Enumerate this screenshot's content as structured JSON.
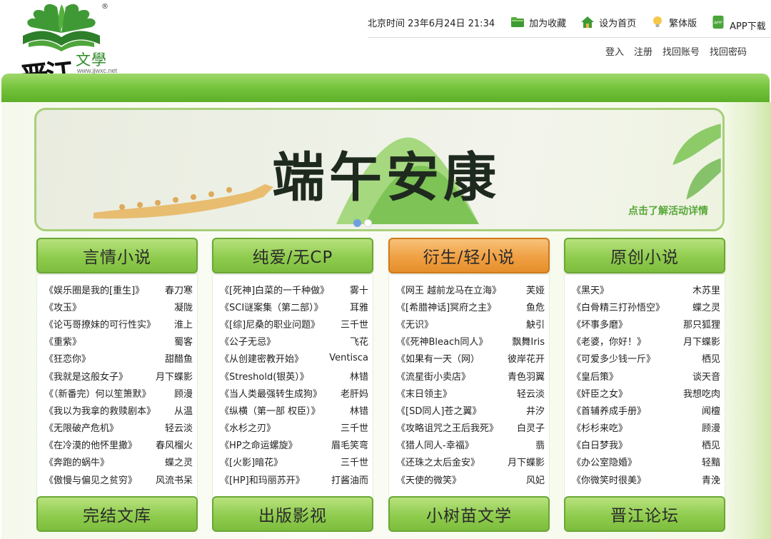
{
  "logo": {
    "brand_big": "晋江",
    "brand_small": "文學城",
    "url": "www.jjwxc.net",
    "reg": "®"
  },
  "topbar": {
    "time_label": "北京时间",
    "time_value": "23年6月24日 21:34",
    "items": [
      {
        "label": "加为收藏",
        "icon": "folder-icon"
      },
      {
        "label": "设为首页",
        "icon": "house-icon"
      },
      {
        "label": "繁体版",
        "icon": "lightbulb-icon"
      },
      {
        "label": "APP下载",
        "icon": "app-icon"
      }
    ]
  },
  "account": {
    "login": "登入",
    "register": "注册",
    "find_account": "找回账号",
    "find_password": "找回密码"
  },
  "banner": {
    "slogan": "端午安康",
    "detail": "点击了解活动详情"
  },
  "colors": {
    "green_accent": "#79c63f",
    "orange_accent": "#f0a043",
    "dot_active": "#6f9fe0",
    "dot_inactive": "#ffffff"
  },
  "columns": [
    {
      "title": "言情小说",
      "footer": "完结文库",
      "active": false,
      "rows": [
        {
          "title": "《娱乐圈是我的[重生]》",
          "author": "春刀寒"
        },
        {
          "title": "《攻玉》",
          "author": "凝陇"
        },
        {
          "title": "《论丐哥撩妹的可行性实》",
          "author": "淮上"
        },
        {
          "title": "《重紫》",
          "author": "蜀客"
        },
        {
          "title": "《狂恋你》",
          "author": "甜醋鱼"
        },
        {
          "title": "《我就是这般女子》",
          "author": "月下蝶影"
        },
        {
          "title": "《（新番完）何以笙箫默》",
          "author": "顾漫"
        },
        {
          "title": "《我以为我拿的救赎剧本》",
          "author": "从温"
        },
        {
          "title": "《无限破产危机》",
          "author": "轻云淡"
        },
        {
          "title": "《在冷漠的他怀里撒》",
          "author": "春风榴火"
        },
        {
          "title": "《奔跑的蜗牛》",
          "author": "蝶之灵"
        },
        {
          "title": "《傲慢与偏见之贫穷》",
          "author": "风流书呆"
        }
      ]
    },
    {
      "title": "纯爱/无CP",
      "footer": "出版影视",
      "active": false,
      "rows": [
        {
          "title": "《[死神]白菜的一千种做》",
          "author": "雾十"
        },
        {
          "title": "《SCI谜案集（第二部）》",
          "author": "耳雅"
        },
        {
          "title": "《[综]尼桑的职业问题》",
          "author": "三千世"
        },
        {
          "title": "《公子无忌》",
          "author": "飞花"
        },
        {
          "title": "《从创建密教开始》",
          "author": "Ventisca"
        },
        {
          "title": "《Streshold(银英）》",
          "author": "林错"
        },
        {
          "title": "《当人类最强转生成狗》",
          "author": "老肝妈"
        },
        {
          "title": "《纵横（第一部 权臣）》",
          "author": "林错"
        },
        {
          "title": "《水杉之刃》",
          "author": "三千世"
        },
        {
          "title": "《HP之命运螺旋》",
          "author": "眉毛笑弯"
        },
        {
          "title": "《[火影]暗花》",
          "author": "三千世"
        },
        {
          "title": "《[HP]和玛丽苏开》",
          "author": "打酱油而"
        }
      ]
    },
    {
      "title": "衍生/轻小说",
      "footer": "小树苗文学",
      "active": true,
      "rows": [
        {
          "title": "《网王 越前龙马在立海》",
          "author": "芙娅"
        },
        {
          "title": "《[希腊神话]冥府之主》",
          "author": "鱼危"
        },
        {
          "title": "《无识》",
          "author": "觖引"
        },
        {
          "title": "《《死神Bleach同人》",
          "author": "飘舞Iris"
        },
        {
          "title": "《如果有一天（网）",
          "author": "彼岸花开"
        },
        {
          "title": "《流星街小卖店》",
          "author": "青色羽翼"
        },
        {
          "title": "《末日领主》",
          "author": "轻云淡"
        },
        {
          "title": "《[SD同人]苍之翼》",
          "author": "井汐"
        },
        {
          "title": "《攻略诅咒之王后我死》",
          "author": "白灵子"
        },
        {
          "title": "《猎人同人-幸福》",
          "author": "翡"
        },
        {
          "title": "《还珠之太后金安》",
          "author": "月下蝶影"
        },
        {
          "title": "《天使的微笑》",
          "author": "风妃"
        }
      ]
    },
    {
      "title": "原创小说",
      "footer": "晋江论坛",
      "active": false,
      "rows": [
        {
          "title": "《黑天》",
          "author": "木苏里"
        },
        {
          "title": "《白骨精三打孙悟空》",
          "author": "蝶之灵"
        },
        {
          "title": "《坏事多磨》",
          "author": "那只狐狸"
        },
        {
          "title": "《老婆，你好！》",
          "author": "月下蝶影"
        },
        {
          "title": "《可爱多少钱一斤》",
          "author": "栖见"
        },
        {
          "title": "《皇后策》",
          "author": "谈天音"
        },
        {
          "title": "《奸臣之女》",
          "author": "我想吃肉"
        },
        {
          "title": "《首辅养成手册》",
          "author": "闻檀"
        },
        {
          "title": "《杉杉来吃》",
          "author": "顾漫"
        },
        {
          "title": "《白日梦我》",
          "author": "栖见"
        },
        {
          "title": "《办公室隐婚》",
          "author": "轻黯"
        },
        {
          "title": "《你微笑时很美》",
          "author": "青浼"
        }
      ]
    }
  ]
}
